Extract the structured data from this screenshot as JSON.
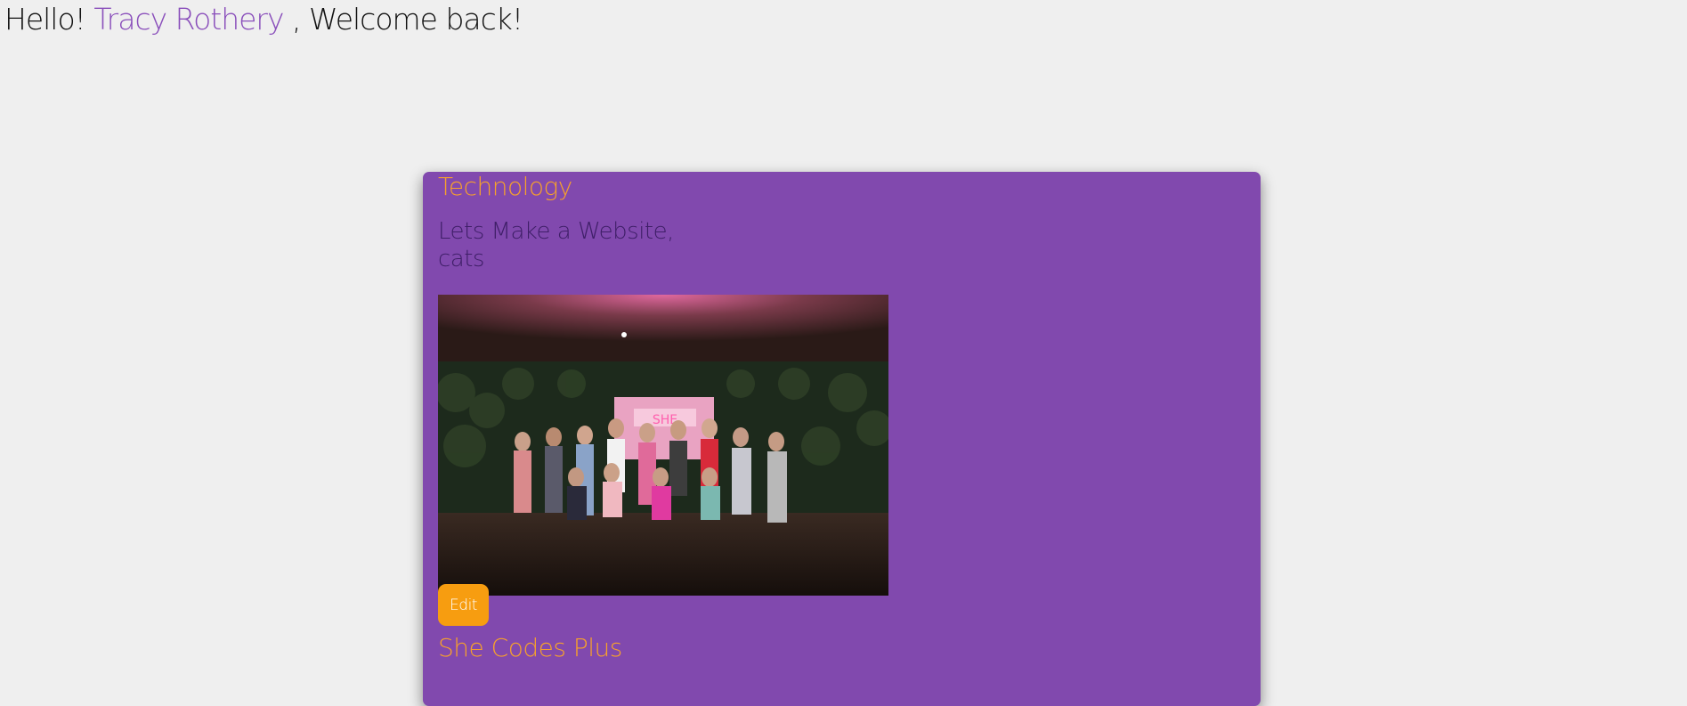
{
  "header": {
    "greeting_prefix": "Hello!",
    "user_name": "Tracy Rothery",
    "greeting_suffix": ", Welcome back!"
  },
  "post": {
    "category": "Technology",
    "title": "Lets Make a Website, cats",
    "image_alt": "group photo of smiling women with arms raised in front of a pink neon sign",
    "edit_label": "Edit",
    "author": "She Codes Plus"
  },
  "colors": {
    "page_bg": "#efefef",
    "card_bg": "#8149ae",
    "accent_orange": "#f7a12b",
    "button_orange": "#f79d10",
    "username_purple": "#8a4fbb",
    "title_dark_purple": "#3f1f68"
  }
}
